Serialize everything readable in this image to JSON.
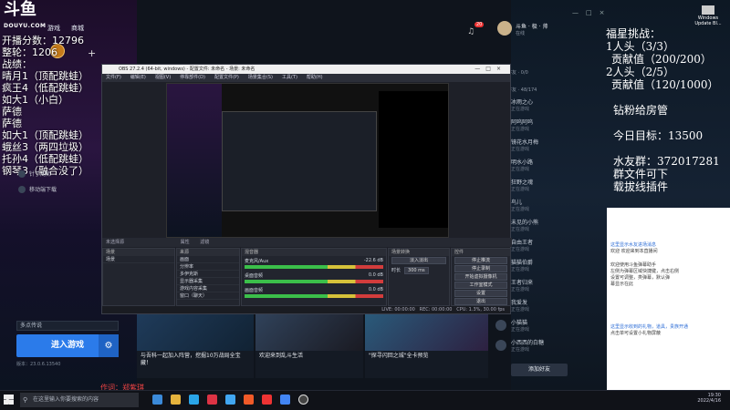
{
  "app": {
    "logo": "斗鱼",
    "logo_sub": "DOUYU.COM",
    "nav": [
      "游戏",
      "商城"
    ],
    "notif_count": "20"
  },
  "overlay": {
    "lines": [
      "开播分数：12796",
      "整轮：1206",
      "战绩：",
      "晴月1（顶配跳蛙）",
      "疯王4（低配跳蛙）",
      "如大1（小白）",
      "萨德",
      "萨德",
      "如大1（顶配跳蛙）",
      "蛾丝3（两四垃圾）",
      "托孙4（低配跳蛙）",
      "钢琴3（融合没了）"
    ]
  },
  "sidebar": {
    "items": [
      "针丁阁师",
      "移动端下载"
    ]
  },
  "obs": {
    "title": "OBS 27.2.4 (64-bit, windows) - 配置文件: 未命名 - 场景: 未命名",
    "menu": [
      "文件(F)",
      "编辑(E)",
      "视图(V)",
      "停靠部件(D)",
      "配置文件(P)",
      "场景集合(S)",
      "工具(T)",
      "帮助(H)"
    ],
    "scene_toolbar": [
      "未选择源",
      "属性",
      "滤镜"
    ],
    "panels": {
      "scenes": "场景",
      "sources": "来源",
      "mixer": "混音器",
      "transitions": "场景转换",
      "controls": "控件"
    },
    "scene_list": [
      "场景"
    ],
    "source_list": [
      "画面",
      "分辨率",
      "多伊克斯",
      "显示器采集",
      "游戏内容采集",
      "窗口（聊天）"
    ],
    "mixer": [
      {
        "name": "麦克风/Aux",
        "db": "-22.6 dB"
      },
      {
        "name": "桌面音频",
        "db": "0.0 dB"
      },
      {
        "name": "画面音频",
        "db": "0.0 dB"
      }
    ],
    "transition": {
      "type": "淡入淡出",
      "duration_label": "时长",
      "duration": "300 ms"
    },
    "controls": [
      "停止推流",
      "停止录制",
      "开始虚拟摄像机",
      "工作室模式",
      "设置",
      "退出"
    ],
    "status": {
      "live": "LIVE: 00:00:00",
      "rec": "REC: 00:00:00",
      "cpu": "CPU: 1.3%, 30.00 fps"
    }
  },
  "launcher": {
    "select_value": "多点传说",
    "enter_btn": "进入游戏",
    "version": "版本：23.0.6.13540"
  },
  "cards": [
    {
      "caption": "与吾科一起加入阵营，挖掘10万战局全宝藏！"
    },
    {
      "caption": "欢迎来到乱斗生活"
    },
    {
      "caption": "\"探寻闪回之城\"全卡预览"
    }
  ],
  "credit": "作词：郑紫琪",
  "stream": {
    "lines": [
      "福星挑战：",
      "1人头（3/3）",
      "贡献值（200/200）",
      "2人头（2/5）",
      "贡献值（120/1000）",
      "钻粉给房管",
      "今日目标：13500",
      "水友群：372017281",
      "群文件可下",
      "载拔线插件"
    ]
  },
  "user_panel": {
    "name": "斗鱼 · 极 · 帅",
    "sub": "在线",
    "count_a": "在线好友 · 0/0",
    "count_b": "在线好友 · 48/174"
  },
  "friends": [
    {
      "name": "冰雨之心",
      "sub": "正在游戏"
    },
    {
      "name": "阿呜阿呜",
      "sub": "正在游戏"
    },
    {
      "name": "镜花水月梅",
      "sub": "正在游戏"
    },
    {
      "name": "明水小路",
      "sub": "正在游戏"
    },
    {
      "name": "狂野之魂",
      "sub": "正在游戏"
    },
    {
      "name": "鸟儿",
      "sub": "正在游戏"
    },
    {
      "name": "未见的小熊",
      "sub": "正在游戏"
    },
    {
      "name": "自由王者",
      "sub": "正在游戏"
    },
    {
      "name": "猫猫伯爵",
      "sub": "正在游戏"
    },
    {
      "name": "王者归来",
      "sub": "正在游戏"
    },
    {
      "name": "我爱发",
      "sub": "正在游戏"
    },
    {
      "name": "小猫猫",
      "sub": "正在游戏"
    },
    {
      "name": "小西西的白糖",
      "sub": "正在游戏"
    }
  ],
  "add_friend_btn": "添加好友",
  "chat": {
    "lines": [
      "这里显示水友进场消息",
      "欢迎 欢迎来到本直播间",
      "欢迎使用斗鱼弹幕助手",
      "左侧为弹幕区域快捷键，点击右侧",
      "设置可调整，类弹幕，默认弹",
      "幕显示在此",
      "这里显示收到的礼物，道具，贵族开通",
      "点击单可设置小礼物屏蔽"
    ]
  },
  "desktop": {
    "item": "Windows Update Bl..."
  },
  "taskbar": {
    "search": "在这里输入你要搜索的内容",
    "time": "19:30",
    "date": "2022/4/16"
  },
  "colors": {
    "accent": "#2b7bea",
    "obs_bg": "#1e2028",
    "stream_text": "#ffffff",
    "green_meter": "#3bbf4a",
    "red_meter": "#d23c3c"
  }
}
